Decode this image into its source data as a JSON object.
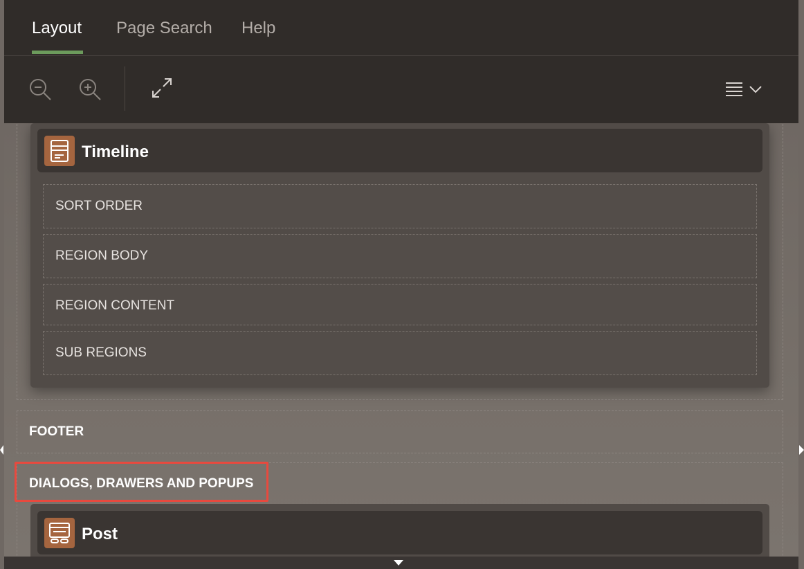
{
  "tabs": [
    {
      "label": "Layout",
      "active": true
    },
    {
      "label": "Page Search",
      "active": false
    },
    {
      "label": "Help",
      "active": false
    }
  ],
  "toolbar": {
    "icons": [
      "zoom-out-icon",
      "zoom-in-icon",
      "expand-icon",
      "menu-icon",
      "chevron-down-icon"
    ]
  },
  "timeline_region": {
    "title": "Timeline",
    "icon": "region-icon",
    "slots": [
      "SORT ORDER",
      "REGION BODY",
      "REGION CONTENT",
      "SUB REGIONS"
    ]
  },
  "sections": {
    "footer": "FOOTER",
    "dialogs": "DIALOGS, DRAWERS AND POPUPS"
  },
  "post_region": {
    "title": "Post",
    "icon": "dialog-region-icon"
  },
  "colors": {
    "accent_tab": "#6c9b5c",
    "region_icon": "#a5653f",
    "highlight": "#e8493e",
    "toolbar_bg": "#302c29"
  }
}
